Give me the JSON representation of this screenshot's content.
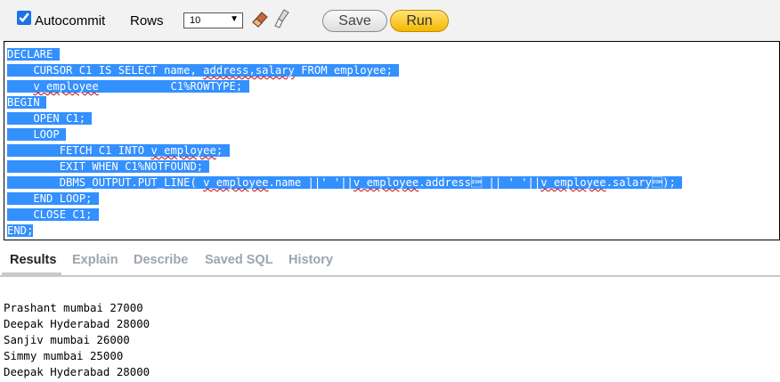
{
  "toolbar": {
    "autocommit_label": "Autocommit",
    "autocommit_checked": true,
    "rows_label": "Rows",
    "rows_value": "10",
    "clear_icon": "eraser-icon",
    "format_icon": "brush-icon",
    "save_label": "Save",
    "run_label": "Run"
  },
  "editor": {
    "lines": [
      "DECLARE",
      "    CURSOR C1 IS SELECT name, address,salary FROM employee;",
      "    v_employee           C1%ROWTYPE;",
      "BEGIN",
      "    OPEN C1;",
      "    LOOP",
      "        FETCH C1 INTO v_employee;",
      "        EXIT WHEN C1%NOTFOUND;",
      "        DBMS_OUTPUT.PUT_LINE( v_employee.name ||' '||v_employee.address || ' '||v_employee.salary);",
      "    END LOOP;",
      "    CLOSE C1;",
      "END;"
    ],
    "selection_color": "#3390ff"
  },
  "tabs": [
    {
      "label": "Results",
      "active": true
    },
    {
      "label": "Explain",
      "active": false
    },
    {
      "label": "Describe",
      "active": false
    },
    {
      "label": "Saved SQL",
      "active": false
    },
    {
      "label": "History",
      "active": false
    }
  ],
  "output": {
    "lines": [
      "Prashant mumbai 27000",
      "Deepak Hyderabad 28000",
      "Sanjiv mumbai 26000",
      "Simmy mumbai 25000",
      "Deepak Hyderabad 28000"
    ]
  }
}
